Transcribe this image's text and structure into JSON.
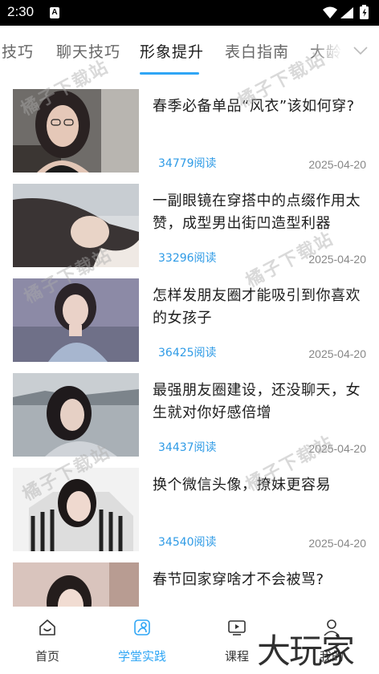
{
  "status_bar": {
    "time": "2:30",
    "notif_badge": "A"
  },
  "tabs": [
    {
      "label": "技巧"
    },
    {
      "label": "聊天技巧"
    },
    {
      "label": "形象提升"
    },
    {
      "label": "表白指南"
    },
    {
      "label": "大龄"
    }
  ],
  "active_tab_index": 2,
  "accent_color": "#2fa6f5",
  "articles": [
    {
      "title": "春季必备单品“风衣”该如何穿?",
      "reads": "34779阅读",
      "date": "2025-04-20"
    },
    {
      "title": "一副眼镜在穿搭中的点缀作用太赞，成型男出街凹造型利器",
      "reads": "33296阅读",
      "date": "2025-04-20"
    },
    {
      "title": "怎样发朋友圈才能吸引到你喜欢的女孩子",
      "reads": "36425阅读",
      "date": "2025-04-20"
    },
    {
      "title": "最强朋友圈建设，还没聊天，女生就对你好感倍增",
      "reads": "34437阅读",
      "date": "2025-04-20"
    },
    {
      "title": "换个微信头像，撩妹更容易",
      "reads": "34540阅读",
      "date": "2025-04-20"
    },
    {
      "title": "春节回家穿啥才不会被骂?",
      "reads": "",
      "date": ""
    }
  ],
  "watermark_text": "橘子下载站",
  "bottom_nav": [
    {
      "label": "首页",
      "icon": "home-icon"
    },
    {
      "label": "学堂实践",
      "icon": "practice-icon"
    },
    {
      "label": "课程",
      "icon": "course-icon"
    },
    {
      "label": "我的",
      "icon": "profile-icon"
    }
  ],
  "active_nav_index": 1,
  "brand_watermark": "大玩家"
}
